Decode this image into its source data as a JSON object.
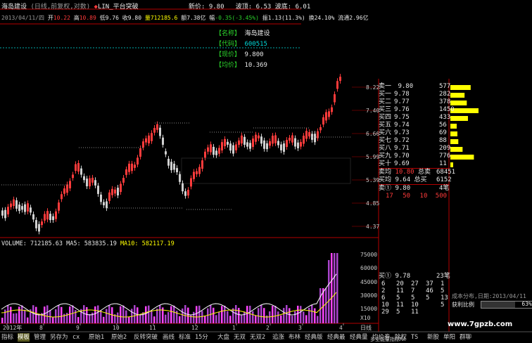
{
  "header": {
    "title": "海岛建设",
    "subtitle": "(日线,前复权,对数)",
    "indicator": "LIN_平台突破",
    "new_price_label": "新价:",
    "new_price": "9.80",
    "wave_top_label": "波顶:",
    "wave_top": "6.53",
    "wave_bottom_label": "波底:",
    "wave_bottom": "6.01"
  },
  "quote_line": {
    "date": "2013/04/11/四",
    "open_label": "开",
    "open": "10.22",
    "high_label": "高",
    "high": "10.89",
    "low_label": "低",
    "low": "9.76",
    "close_label": "收",
    "close": "9.80",
    "volume_label": "量",
    "volume": "712185.6",
    "amount_label": "额",
    "amount": "7.38亿",
    "change_label": "幅",
    "change": "-0.35(-3.45%)",
    "turnover_label": "振",
    "turnover": "1.13(11.3%)",
    "exchange_label": "换",
    "exchange": "24.10%",
    "float_label": "流通",
    "float": "2.96亿"
  },
  "info_box": [
    {
      "label": "【名称】",
      "value": "海岛建设"
    },
    {
      "label": "【代码】",
      "value": "600515"
    },
    {
      "label": "【现价】",
      "value": "9.800"
    },
    {
      "label": "【均价】",
      "value": "10.369"
    }
  ],
  "price_axis": [
    "8.22",
    "7.40",
    "6.66",
    "5.99",
    "5.39",
    "4.85",
    "4.37"
  ],
  "volume_axis": [
    "75000",
    "60000",
    "45000",
    "30000",
    "15000",
    "X10"
  ],
  "volume_header": {
    "vol_label": "VOLUME:",
    "vol": "712185.63",
    "ma5_label": "MA5:",
    "ma5": "583835.19",
    "ma10_label": "MA10:",
    "ma10": "582117.19"
  },
  "date_axis": [
    "2012年",
    "8",
    "9",
    "10",
    "11",
    "12",
    "1",
    "2",
    "3",
    "4"
  ],
  "date_axis_right": "日线",
  "order_book": {
    "sell": [
      {
        "label": "卖一",
        "price": "9.80",
        "vol": "577"
      }
    ],
    "buy": [
      {
        "label": "买一",
        "price": "9.78",
        "vol": "282"
      },
      {
        "label": "买二",
        "price": "9.77",
        "vol": "378"
      },
      {
        "label": "买三",
        "price": "9.76",
        "vol": "1450"
      },
      {
        "label": "买四",
        "price": "9.75",
        "vol": "433"
      },
      {
        "label": "买五",
        "price": "9.74",
        "vol": "56"
      },
      {
        "label": "买六",
        "price": "9.73",
        "vol": "69"
      },
      {
        "label": "买七",
        "price": "9.72",
        "vol": "88"
      },
      {
        "label": "买八",
        "price": "9.71",
        "vol": "209"
      },
      {
        "label": "买九",
        "price": "9.70",
        "vol": "776"
      },
      {
        "label": "买十",
        "price": "9.69",
        "vol": "11"
      }
    ],
    "sell_avg_label": "卖均",
    "sell_avg": "10.80",
    "total_sell_label": "总卖",
    "total_sell": "68451",
    "buy_avg_label": "买均",
    "buy_avg": "9.64",
    "total_buy_label": "总买",
    "total_buy": "6152",
    "queue1_label": "卖①",
    "queue1_price": "9.80",
    "queue1_count": "4笔",
    "queue1_values": [
      "17",
      "50",
      "10",
      "500"
    ]
  },
  "buy_queue": {
    "label": "买①",
    "price": "9.78",
    "count": "23笔",
    "rows": [
      [
        "6",
        "20",
        "27",
        "37",
        "1"
      ],
      [
        "2",
        "11",
        "7",
        "46",
        "5"
      ],
      [
        "6",
        "5",
        "5",
        "5",
        "13"
      ],
      [
        "10",
        "11",
        "10",
        "",
        "5"
      ],
      [
        "29",
        "5",
        "11",
        "",
        ""
      ]
    ]
  },
  "cost_panel": {
    "cost_label": "成本分布,日期:",
    "cost_date": "2013/04/11",
    "profit_label": "获利比例",
    "profit_value": "63%"
  },
  "bottom_menu": [
    "指标",
    "模板",
    "管理",
    "另存为",
    "cx",
    "原始1",
    "原始2",
    "反转突破",
    "画线",
    "标准",
    "15分",
    "大盘",
    "无双",
    "无双2",
    "追涨",
    "布林",
    "经典版",
    "经典最",
    "经典量",
    "均价券",
    "除权",
    "TS",
    "新股",
    "单阳",
    "群聊"
  ],
  "bottom_menu_extra": "多空能量指标MA",
  "watermark": "www.7gpzb.com",
  "colors": {
    "up": "#ff3b3b",
    "down": "#00c8c8",
    "bg": "#000000",
    "axis": "#b40000",
    "yellow": "#ffff00"
  }
}
